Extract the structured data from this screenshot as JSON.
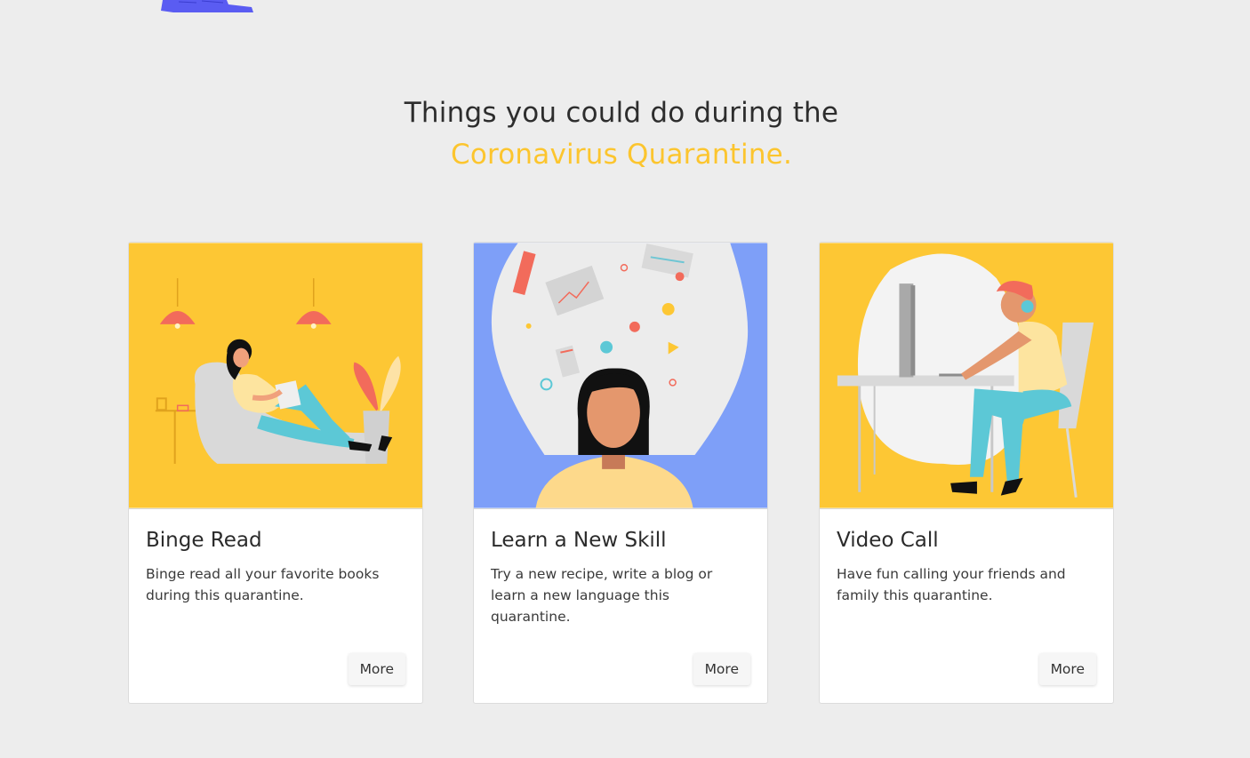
{
  "colors": {
    "background": "#ededed",
    "accent": "#fcc52e",
    "heading": "#2d2d2d"
  },
  "section": {
    "heading_line1": "Things you could do during the",
    "heading_line2": "Coronavirus Quarantine."
  },
  "cards": [
    {
      "title": "Binge Read",
      "text": "Binge read all your favorite books during this quarantine.",
      "button": "More",
      "illustration": "woman-reading-illustration"
    },
    {
      "title": "Learn a New Skill",
      "text": "Try a new recipe, write a blog or learn a new language this quarantine.",
      "button": "More",
      "illustration": "woman-learning-illustration"
    },
    {
      "title": "Video Call",
      "text": "Have fun calling your friends and family this quarantine.",
      "button": "More",
      "illustration": "man-video-call-illustration"
    }
  ]
}
